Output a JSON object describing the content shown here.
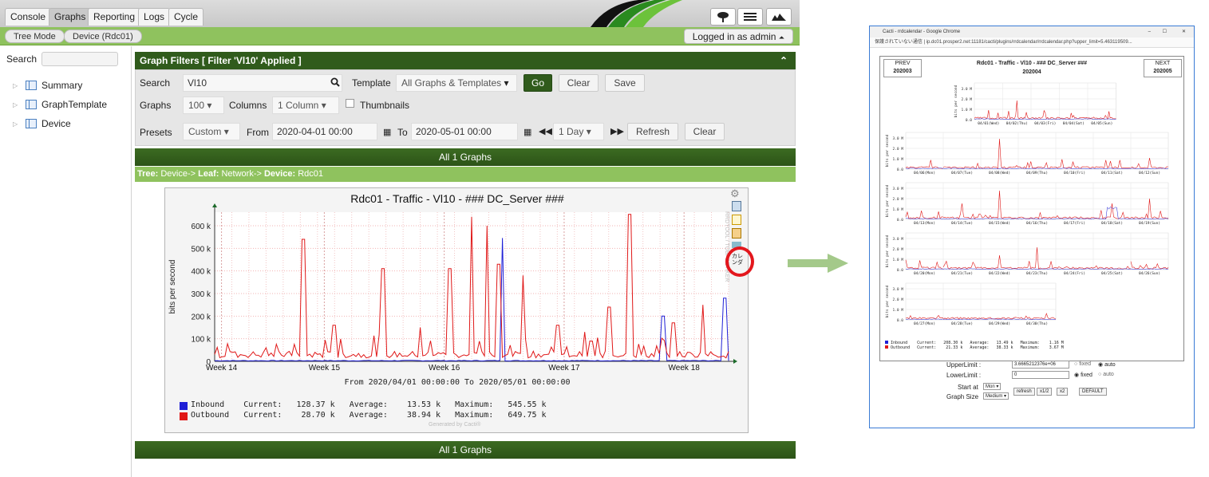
{
  "tabs": [
    "Console",
    "Graphs",
    "Reporting",
    "Logs",
    "Cycle"
  ],
  "breadcrumb": [
    "Tree Mode",
    "Device (Rdc01)"
  ],
  "login_text": "Logged in as admin",
  "sidebar": {
    "search_label": "Search",
    "items": [
      "Summary",
      "GraphTemplate",
      "Device"
    ]
  },
  "filters": {
    "header": "Graph Filters [ Filter 'Vl10' Applied ]",
    "search_label": "Search",
    "search_value": "Vl10",
    "template_label": "Template",
    "template_value": "All Graphs & Templates",
    "go": "Go",
    "clear": "Clear",
    "save": "Save",
    "graphs_label": "Graphs",
    "graphs_value": "100",
    "columns_label": "Columns",
    "columns_value": "1 Column",
    "thumbnails": "Thumbnails",
    "presets_label": "Presets",
    "presets_value": "Custom",
    "from_label": "From",
    "from_value": "2020-04-01 00:00",
    "to_label": "To",
    "to_value": "2020-05-01 00:00",
    "span_value": "1 Day",
    "refresh": "Refresh",
    "clear2": "Clear"
  },
  "all_graphs": "All 1 Graphs",
  "tree_path": {
    "tree_lbl": "Tree:",
    "tree_val": "Device->",
    "leaf_lbl": "Leaf:",
    "leaf_val": "Network->",
    "device_lbl": "Device:",
    "device_val": "Rdc01"
  },
  "graph": {
    "title": "Rdc01 - Traffic - Vl10 - ### DC_Server ###",
    "ylabel": "bits per second",
    "side_text": "RRDTOOL / TOBI OETIKER",
    "range": "From 2020/04/01 00:00:00 To 2020/05/01 00:00:00",
    "legend": [
      {
        "name": "Inbound",
        "line": "Current:   128.37 k   Average:    13.53 k   Maximum:   545.55 k",
        "color": "#1f1fd6"
      },
      {
        "name": "Outbound",
        "line": "Current:    28.70 k   Average:    38.94 k   Maximum:   649.75 k",
        "color": "#e01818"
      }
    ],
    "generated": "Generated by Cacti®",
    "cal_icon_text": "カレンダ"
  },
  "chart_data": {
    "type": "line",
    "title": "Rdc01 - Traffic - Vl10 - ### DC_Server ###",
    "ylabel": "bits per second",
    "yticks": [
      "0",
      "100 k",
      "200 k",
      "300 k",
      "400 k",
      "500 k",
      "600 k"
    ],
    "ylim": [
      0,
      660000
    ],
    "xticks": [
      "Week 14",
      "Week 15",
      "Week 16",
      "Week 17",
      "Week 18"
    ],
    "series": [
      {
        "name": "Inbound",
        "color": "#1f1fd6",
        "stats": {
          "current": 128370,
          "average": 13530,
          "maximum": 545550
        },
        "peaks": [
          [
            16.8,
            545550
          ],
          [
            26.2,
            200000
          ],
          [
            29.8,
            280000
          ]
        ]
      },
      {
        "name": "Outbound",
        "color": "#e01818",
        "stats": {
          "current": 28700,
          "average": 38940,
          "maximum": 649750
        },
        "peaks": [
          [
            1,
            40000
          ],
          [
            3,
            60000
          ],
          [
            5.2,
            540000
          ],
          [
            7,
            160000
          ],
          [
            9.8,
            410000
          ],
          [
            12,
            150000
          ],
          [
            13.7,
            410000
          ],
          [
            15,
            640000
          ],
          [
            15.9,
            600000
          ],
          [
            16.6,
            430000
          ],
          [
            18,
            380000
          ],
          [
            20,
            160000
          ],
          [
            21.6,
            130000
          ],
          [
            22,
            90000
          ],
          [
            23,
            240000
          ],
          [
            24.2,
            650000
          ],
          [
            26.8,
            170000
          ],
          [
            28.5,
            250000
          ]
        ]
      }
    ]
  },
  "popup": {
    "window_title": "Cacti - rrdcalendar - Google Chrome",
    "url": "保護されていない通信 | ip.dc01.prosper2.net:11181/cacti/plugins/rrdcalendar/rrdcalendar.php?upper_limit=5.463119509...",
    "prev_label": "PREV",
    "prev_value": "202003",
    "next_label": "NEXT",
    "next_value": "202005",
    "title": "Rdc01 - Traffic - Vl10 - ### DC_Server ###",
    "month": "202004",
    "weeks": [
      [
        "04/01(Wed)",
        "04/02(Thu)",
        "04/03(Fri)",
        "04/04(Sat)",
        "04/05(Sun)"
      ],
      [
        "04/06(Mon)",
        "04/07(Tue)",
        "04/08(Wed)",
        "04/09(Thu)",
        "04/10(Fri)",
        "04/11(Sat)",
        "04/12(Sun)"
      ],
      [
        "04/13(Mon)",
        "04/14(Tue)",
        "04/15(Wed)",
        "04/16(Thu)",
        "04/17(Fri)",
        "04/18(Sat)",
        "04/19(Sun)"
      ],
      [
        "04/20(Mon)",
        "04/21(Tue)",
        "04/22(Wed)",
        "04/23(Thu)",
        "04/24(Fri)",
        "04/25(Sat)",
        "04/26(Sun)"
      ],
      [
        "04/27(Mon)",
        "04/28(Tue)",
        "04/29(Wed)",
        "04/30(Thu)"
      ]
    ],
    "mini_ylabel": "bits per second",
    "mini_yticks": [
      "0.0",
      "1.0 M",
      "2.0 M",
      "3.0 M"
    ],
    "legend_in": "Inbound    Current:   208.30 k   Average:   13.49 k   Maximum:    1.16 M",
    "legend_out": "Outbound   Current:    21.33 k   Average:   38.33 k   Maximum:    3.67 M",
    "upper_label": "UpperLimit :",
    "upper_value": "3.6665212376e+06",
    "fixed": "fixed",
    "auto": "auto",
    "lower_label": "LowerLimit :",
    "lower_value": "0",
    "startat_label": "Start at",
    "startat_value": "Mon",
    "graphsize_label": "Graph Size",
    "graphsize_value": "Medium",
    "btn_refresh": "refresh",
    "btn_half": "x1/2",
    "btn_double": "x2",
    "btn_default": "DEFAULT"
  }
}
